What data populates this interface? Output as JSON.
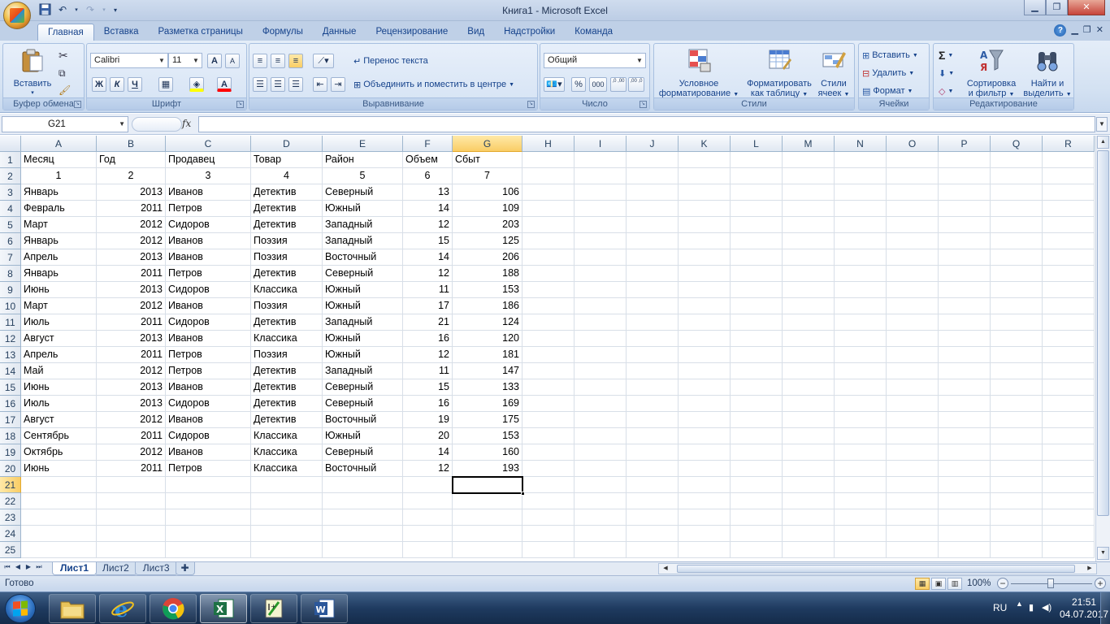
{
  "window": {
    "title": "Книга1 - Microsoft Excel"
  },
  "ribbon": {
    "tabs": [
      "Главная",
      "Вставка",
      "Разметка страницы",
      "Формулы",
      "Данные",
      "Рецензирование",
      "Вид",
      "Надстройки",
      "Команда"
    ],
    "groups": {
      "clipboard": {
        "label": "Буфер обмена",
        "paste": "Вставить"
      },
      "font": {
        "label": "Шрифт",
        "font_name": "Calibri",
        "font_size": "11",
        "bold": "Ж",
        "italic": "К",
        "underline": "Ч"
      },
      "alignment": {
        "label": "Выравнивание",
        "wrap": "Перенос текста",
        "merge": "Объединить и поместить в центре"
      },
      "number": {
        "label": "Число",
        "format": "Общий",
        "percent": "%",
        "thousands": "000",
        "inc": ",0 ,00",
        "dec": ",00 ,0"
      },
      "styles": {
        "label": "Стили",
        "conditional_1": "Условное",
        "conditional_2": "форматирование",
        "table_1": "Форматировать",
        "table_2": "как таблицу",
        "cell_1": "Стили",
        "cell_2": "ячеек"
      },
      "cells": {
        "label": "Ячейки",
        "insert": "Вставить",
        "delete": "Удалить",
        "format": "Формат"
      },
      "editing": {
        "label": "Редактирование",
        "sum": "Σ",
        "sort_1": "Сортировка",
        "sort_2": "и фильтр",
        "find_1": "Найти и",
        "find_2": "выделить"
      }
    }
  },
  "formula_bar": {
    "name_box": "G21",
    "fx": "fx",
    "value": ""
  },
  "grid": {
    "columns": [
      "A",
      "B",
      "C",
      "D",
      "E",
      "F",
      "G",
      "H",
      "I",
      "J",
      "K",
      "L",
      "M",
      "N",
      "O",
      "P",
      "Q",
      "R"
    ],
    "rows": [
      "1",
      "2",
      "3",
      "4",
      "5",
      "6",
      "7",
      "8",
      "9",
      "10",
      "11",
      "12",
      "13",
      "14",
      "15",
      "16",
      "17",
      "18",
      "19",
      "20",
      "21",
      "22",
      "23",
      "24",
      "25"
    ],
    "selected_cell": "G21",
    "cells": [
      [
        "Месяц",
        "Год",
        "Продавец",
        "Товар",
        "Район",
        "Объем",
        "Сбыт"
      ],
      [
        "1",
        "2",
        "3",
        "4",
        "5",
        "6",
        "7"
      ],
      [
        "Январь",
        "2013",
        "Иванов",
        "Детектив",
        "Северный",
        "13",
        "106"
      ],
      [
        "Февраль",
        "2011",
        "Петров",
        "Детектив",
        "Южный",
        "14",
        "109"
      ],
      [
        "Март",
        "2012",
        "Сидоров",
        "Детектив",
        "Западный",
        "12",
        "203"
      ],
      [
        "Январь",
        "2012",
        "Иванов",
        "Поэзия",
        "Западный",
        "15",
        "125"
      ],
      [
        "Апрель",
        "2013",
        "Иванов",
        "Поэзия",
        "Восточный",
        "14",
        "206"
      ],
      [
        "Январь",
        "2011",
        "Петров",
        "Детектив",
        "Северный",
        "12",
        "188"
      ],
      [
        "Июнь",
        "2013",
        "Сидоров",
        "Классика",
        "Южный",
        "11",
        "153"
      ],
      [
        "Март",
        "2012",
        "Иванов",
        "Поэзия",
        "Южный",
        "17",
        "186"
      ],
      [
        "Июль",
        "2011",
        "Сидоров",
        "Детектив",
        "Западный",
        "21",
        "124"
      ],
      [
        "Август",
        "2013",
        "Иванов",
        "Классика",
        "Южный",
        "16",
        "120"
      ],
      [
        "Апрель",
        "2011",
        "Петров",
        "Поэзия",
        "Южный",
        "12",
        "181"
      ],
      [
        "Май",
        "2012",
        "Петров",
        "Детектив",
        "Западный",
        "11",
        "147"
      ],
      [
        "Июнь",
        "2013",
        "Иванов",
        "Детектив",
        "Северный",
        "15",
        "133"
      ],
      [
        "Июль",
        "2013",
        "Сидоров",
        "Детектив",
        "Северный",
        "16",
        "169"
      ],
      [
        "Август",
        "2012",
        "Иванов",
        "Детектив",
        "Восточный",
        "19",
        "175"
      ],
      [
        "Сентябрь",
        "2011",
        "Сидоров",
        "Классика",
        "Южный",
        "20",
        "153"
      ],
      [
        "Октябрь",
        "2012",
        "Иванов",
        "Классика",
        "Северный",
        "14",
        "160"
      ],
      [
        "Июнь",
        "2011",
        "Петров",
        "Классика",
        "Восточный",
        "12",
        "193"
      ]
    ]
  },
  "sheets": {
    "tabs": [
      "Лист1",
      "Лист2",
      "Лист3"
    ],
    "active": "Лист1"
  },
  "status": {
    "text": "Готово",
    "zoom": "100%"
  },
  "taskbar": {
    "lang": "RU",
    "time": "21:51",
    "date": "04.07.2017"
  }
}
